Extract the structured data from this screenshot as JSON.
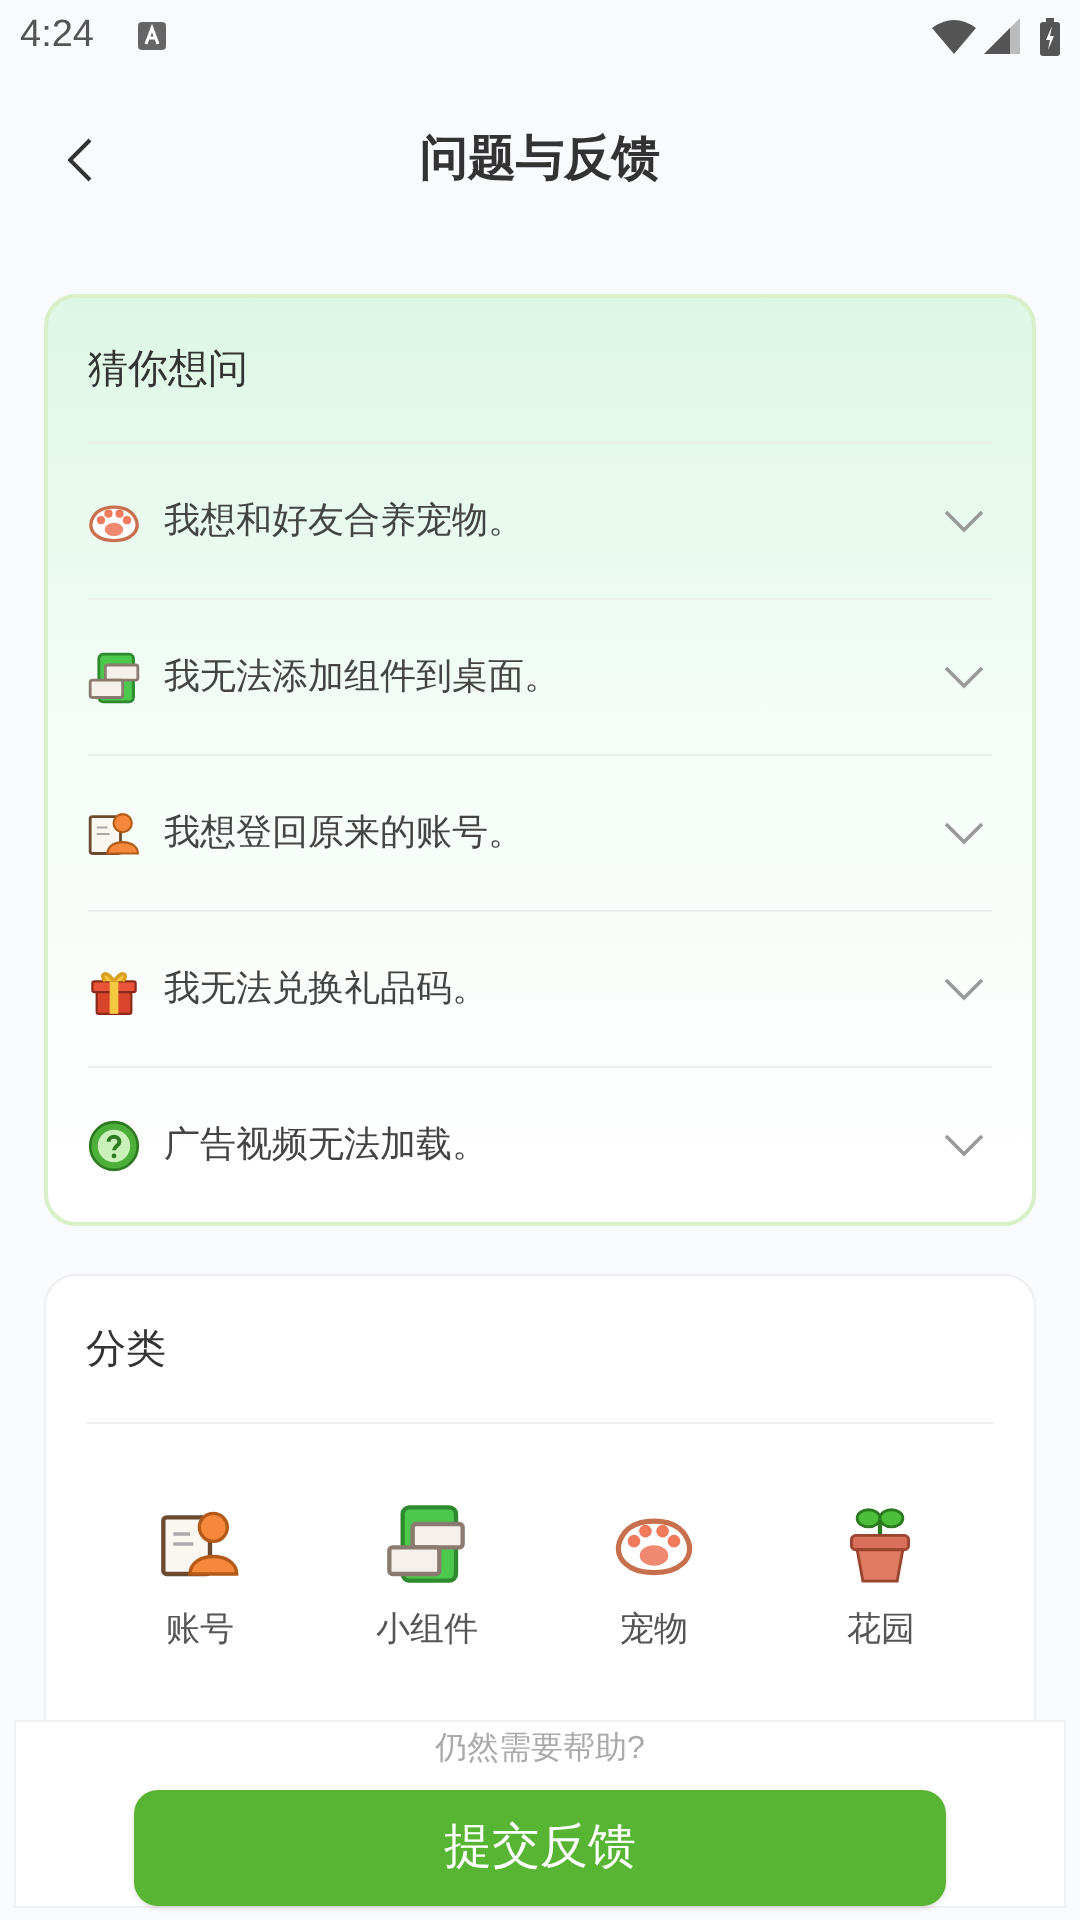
{
  "status_bar": {
    "time": "4:24"
  },
  "header": {
    "title": "问题与反馈"
  },
  "faq": {
    "title": "猜你想问",
    "items": [
      {
        "kind": "paw",
        "text": "我想和好友合养宠物。",
        "expanded": false
      },
      {
        "kind": "widget",
        "text": "我无法添加组件到桌面。",
        "expanded": false
      },
      {
        "kind": "account",
        "text": "我想登回原来的账号。",
        "expanded": false
      },
      {
        "kind": "gift",
        "text": "我无法兑换礼品码。",
        "expanded": false
      },
      {
        "kind": "help",
        "text": "广告视频无法加载。",
        "expanded": false
      }
    ]
  },
  "categories": {
    "title": "分类",
    "items": [
      {
        "kind": "account",
        "label": "账号"
      },
      {
        "kind": "widget",
        "label": "小组件"
      },
      {
        "kind": "paw",
        "label": "宠物"
      },
      {
        "kind": "garden",
        "label": "花园"
      }
    ]
  },
  "footer": {
    "hint": "仍然需要帮助?",
    "button": "提交反馈"
  }
}
